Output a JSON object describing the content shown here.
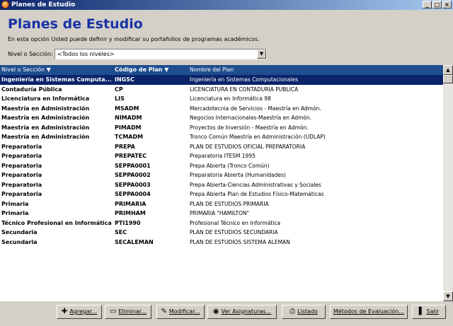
{
  "window": {
    "title": "Planes de Estudio",
    "buttons": [
      "_",
      "□",
      "×"
    ]
  },
  "header": {
    "title": "Planes de Estudio",
    "description": "En esta opción Usted puede definir y modificar su portafolios de programas académicos.",
    "filter_label": "Nivel o Sección:",
    "filter_value": "<Todos los niveles>"
  },
  "table": {
    "columns": [
      "Nivel o Sección ▼",
      "Código de Plan ▼",
      "Nombre del Plan"
    ],
    "rows": [
      {
        "nivel": "Ingeniería en Sistemas Computa...",
        "codigo": "INGSC",
        "nombre": "Ingeniería en Sistemas Computacionales",
        "selected": true
      },
      {
        "nivel": "Contaduría Pública",
        "codigo": "CP",
        "nombre": "LICENCIATURA EN CONTADURIA PUBLICA"
      },
      {
        "nivel": "Licenciatura en Informática",
        "codigo": "LIS",
        "nombre": "Licenciatura en Informática 98"
      },
      {
        "nivel": "Maestría en Administración",
        "codigo": "MSADM",
        "nombre": "Mercadotecnia de Servicios - Maestría en Admón."
      },
      {
        "nivel": "Maestría en Administración",
        "codigo": "NIMADM",
        "nombre": "Negocios Internacionales-Maestría en Admón."
      },
      {
        "nivel": "Maestría en Administración",
        "codigo": "PIMADM",
        "nombre": "Proyectos de Inversión - Maestría en Admón."
      },
      {
        "nivel": "Maestría en Administración",
        "codigo": "TCMADM",
        "nombre": "Tronco Común Maestría en Administración (UDLAP)"
      },
      {
        "nivel": "Preparatoria",
        "codigo": "PREPA",
        "nombre": "PLAN DE ESTUDIOS OFICIAL PREPARATORIA"
      },
      {
        "nivel": "Preparatoria",
        "codigo": "PREPATEC",
        "nombre": "Preparatoria ITESM 1995"
      },
      {
        "nivel": "Preparatoria",
        "codigo": "SEPPA0001",
        "nombre": "Prepa Abierta (Tronco Común)"
      },
      {
        "nivel": "Preparatoria",
        "codigo": "SEPPA0002",
        "nombre": "Preparatoria Abierta (Humanidades)"
      },
      {
        "nivel": "Preparatoria",
        "codigo": "SEPPA0003",
        "nombre": "Prepa Abierta-Ciencias Administrativas y Sociales"
      },
      {
        "nivel": "Preparatoria",
        "codigo": "SEPPA0004",
        "nombre": "Prepa Abierta Plan de Estudios Físico-Matemáticas"
      },
      {
        "nivel": "Primaria",
        "codigo": "PRIMARIA",
        "nombre": "PLAN DE ESTUDIOS PRIMARIA"
      },
      {
        "nivel": "Primaria",
        "codigo": "PRIMHAM",
        "nombre": "PRIMARIA \"HAMILTON\""
      },
      {
        "nivel": "Técnico Profesional en Informática",
        "codigo": "PTI1990",
        "nombre": "Profesional Técnico en Informática"
      },
      {
        "nivel": "Secundaria",
        "codigo": "SEC",
        "nombre": "PLAN DE ESTUDIOS SECUNDARIA"
      },
      {
        "nivel": "Secundaria",
        "codigo": "SECALEMAN",
        "nombre": "PLAN DE ESTUDIOS SISTEMA ALEMAN"
      }
    ]
  },
  "footer": {
    "buttons": [
      {
        "name": "agregar-button",
        "icon": "plus-icon",
        "glyph": "✚",
        "label": "Agregar..."
      },
      {
        "name": "eliminar-button",
        "icon": "delete-icon",
        "glyph": "▭",
        "label": "Eliminar..."
      },
      {
        "name": "modificar-button",
        "icon": "pencil-icon",
        "glyph": "✎",
        "label": "Modificar..."
      },
      {
        "name": "ver-asignaturas-button",
        "icon": "eye-icon",
        "glyph": "◉",
        "label": "Ver Asignaturas..."
      },
      {
        "name": "listado-button",
        "icon": "printer-icon",
        "glyph": "⎙",
        "label": "Listado"
      },
      {
        "name": "metodos-evaluacion-button",
        "icon": "",
        "glyph": "",
        "label": "Métodos de Evaluación..."
      },
      {
        "name": "salir-button",
        "icon": "exit-icon",
        "glyph": "▌",
        "label": "Salir"
      }
    ]
  }
}
